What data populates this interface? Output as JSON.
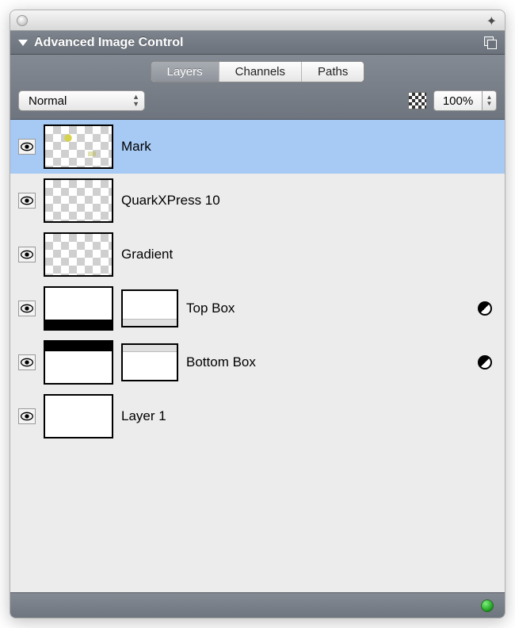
{
  "panel": {
    "title": "Advanced Image Control"
  },
  "tabs": {
    "layers": "Layers",
    "channels": "Channels",
    "paths": "Paths",
    "active": "layers"
  },
  "blend": {
    "mode": "Normal"
  },
  "opacity": {
    "value": "100%"
  },
  "layers": [
    {
      "name": "Mark",
      "selected": true,
      "thumb": "mark-transparent",
      "hasMask": false
    },
    {
      "name": "QuarkXPress 10",
      "selected": false,
      "thumb": "transparent",
      "hasMask": false
    },
    {
      "name": "Gradient",
      "selected": false,
      "thumb": "transparent",
      "hasMask": false
    },
    {
      "name": "Top Box",
      "selected": false,
      "thumb": "topbox",
      "mask": "mask-top",
      "hasMask": true
    },
    {
      "name": "Bottom Box",
      "selected": false,
      "thumb": "bottombox",
      "mask": "mask-bottom",
      "hasMask": true
    },
    {
      "name": "Layer 1",
      "selected": false,
      "thumb": "white",
      "hasMask": false
    }
  ]
}
